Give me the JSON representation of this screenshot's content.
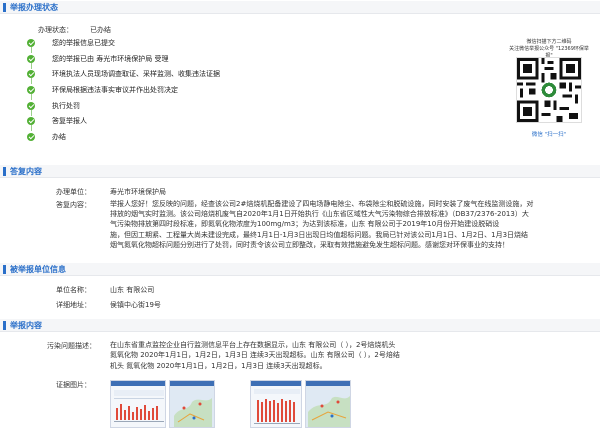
{
  "status_section": {
    "title": "举报办理状态",
    "status_label": "办理状态：",
    "status_value": "已办结",
    "steps": [
      "您的举报信息已提交",
      "您的举报已由 寿光市环境保护局 受理",
      "环境执法人员现场调查取证、采样监测、收集违法证据",
      "环保局根据违法事实审议并作出处罚决定",
      "执行处罚",
      "答复举报人",
      "办结"
    ]
  },
  "qr": {
    "line1": "微信扫描下方二维码",
    "line2": "关注微信举报公众号 \"12369环保举报\"",
    "caption": "微信 \"扫一扫\""
  },
  "reply_section": {
    "title": "答复内容",
    "unit_label": "办理单位：",
    "unit_value": "寿光市环境保护局",
    "content_label": "答复内容：",
    "content_lines": [
      "举报人您好！您反映的问题，经查该公司2#焙烧机配备建设了四电场静电除尘、布袋除尘和脱硫设施，同时安装了废气在线监测设施，对",
      "排放的烟气实时监测。该公司焙烧机废气自2020年1月1日开始执行《山东省区域性大气污染物综合排放标准》（DB37/2376-2013）大",
      "气污染物排放第四时段标准，即氮氧化物浓度为100mg/m3；为达到该标准，山东          有限公司于2019年10月份开始建设脱硝设",
      "施，但因工期紧、工程量大尚未建设完成，最终1月1日-1月3日出现日均值超标问题。我局已针对该公司1月1日、1月2日、1月3日烧结",
      "烟气氮氧化物超标问题分别进行了处罚，同时责令该公司立即整改，采取有效措施避免发生超标问题。感谢您对环保事业的支持！"
    ]
  },
  "unit_section": {
    "title": "被举报单位信息",
    "name_label": "单位名称：",
    "name_value": "山东          有限公司",
    "address_label": "详细地址：",
    "address_value": "侯镇中心街19号"
  },
  "report_section": {
    "title": "举报内容",
    "desc_label": "污染问题描述：",
    "desc_lines": [
      "在山东省重点监控企业自行监测信息平台上存在数据显示，山东          有限公司（                                    ），2号焙烧机头",
      "氮氧化物 2020年1月1日，1月2日，1月3日 连续3天出现超标。山东          有限公司（                                    ），2号焙结",
      "机头 氮氧化物 2020年1月1日，1月2日，1月3日 连续3天出现超标。"
    ],
    "evidence_label": "证据图片："
  },
  "colors": {
    "accent": "#2a6fc9",
    "success": "#52b035"
  }
}
